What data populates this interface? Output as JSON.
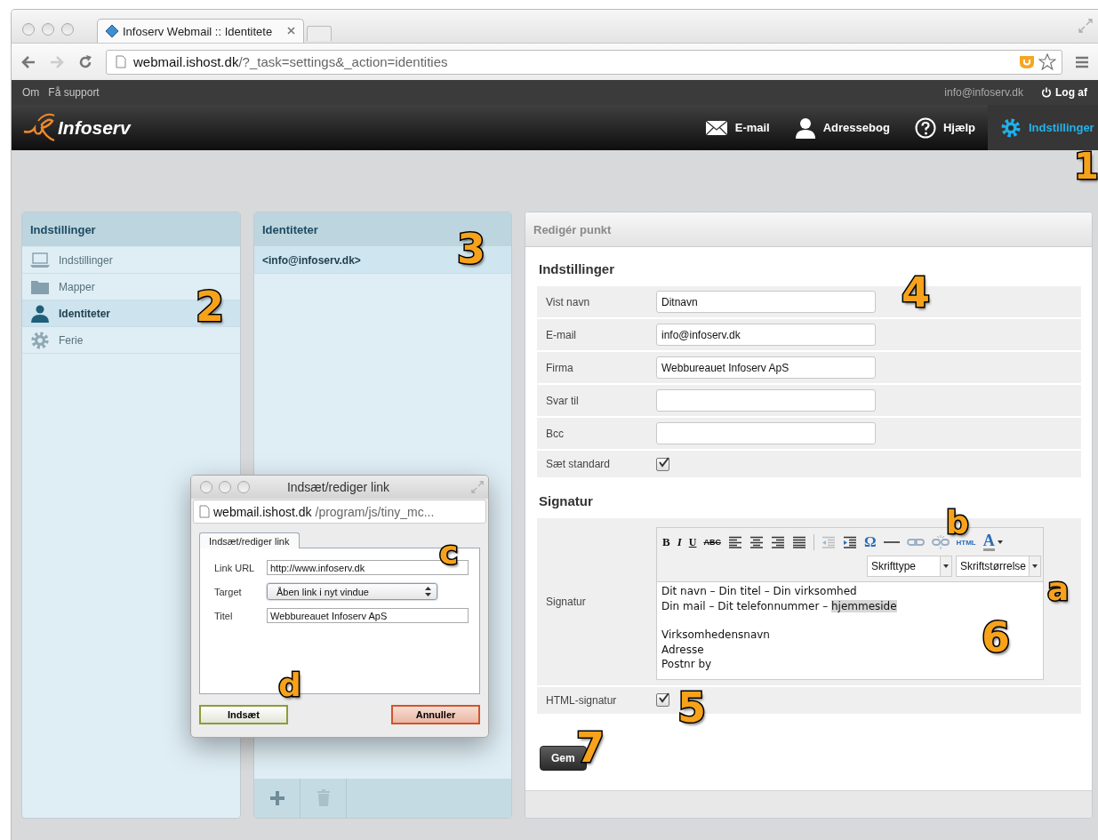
{
  "browser": {
    "tab_title": "Infoserv Webmail :: Identitete",
    "url_host": "webmail.ishost.dk",
    "url_path": "/?_task=settings&_action=identities"
  },
  "topbar": {
    "links": [
      "Om",
      "Få support"
    ],
    "user": "info@infoserv.dk",
    "logout": "Log af"
  },
  "header": {
    "logo": "Infoserv",
    "nav": [
      {
        "label": "E-mail",
        "selected": false
      },
      {
        "label": "Adressebog",
        "selected": false
      },
      {
        "label": "Hjælp",
        "selected": false
      },
      {
        "label": "Indstillinger",
        "selected": true
      }
    ]
  },
  "settings_panel": {
    "title": "Indstillinger",
    "items": [
      {
        "label": "Indstillinger",
        "selected": false
      },
      {
        "label": "Mapper",
        "selected": false
      },
      {
        "label": "Identiteter",
        "selected": true
      },
      {
        "label": "Ferie",
        "selected": false
      }
    ]
  },
  "identities_panel": {
    "title": "Identiteter",
    "items": [
      {
        "label": "<info@infoserv.dk>",
        "selected": true
      }
    ]
  },
  "edit_panel": {
    "title": "Redigér punkt",
    "save": "Gem",
    "sections": [
      {
        "title": "Indstillinger",
        "rows": [
          {
            "label": "Vist navn",
            "kind": "text",
            "value": "Ditnavn"
          },
          {
            "label": "E-mail",
            "kind": "text",
            "value": "info@infoserv.dk"
          },
          {
            "label": "Firma",
            "kind": "text",
            "value": "Webbureauet Infoserv ApS"
          },
          {
            "label": "Svar til",
            "kind": "text"
          },
          {
            "label": "Bcc",
            "kind": "text"
          },
          {
            "label": "Sæt standard",
            "kind": "checkbox",
            "checked": true
          }
        ]
      },
      {
        "title": "Signatur",
        "rows": [
          {
            "label": "Signatur",
            "kind": "editor"
          },
          {
            "label": "HTML-signatur",
            "kind": "checkbox",
            "checked": true
          }
        ]
      }
    ]
  },
  "editor": {
    "toolbar": [
      {
        "kind": "bold",
        "label": "B"
      },
      {
        "kind": "italic",
        "label": "I"
      },
      {
        "kind": "underline",
        "label": "U"
      },
      {
        "kind": "strike",
        "label": "ABC"
      },
      {
        "kind": "align-left"
      },
      {
        "kind": "align-center"
      },
      {
        "kind": "align-right"
      },
      {
        "kind": "align-justify"
      },
      {
        "kind": "separator"
      },
      {
        "kind": "outdent",
        "disabled": true
      },
      {
        "kind": "indent",
        "disabled": false
      },
      {
        "kind": "charmap",
        "label": "Ω"
      },
      {
        "kind": "hr"
      },
      {
        "kind": "link",
        "disabled": true
      },
      {
        "kind": "unlink",
        "disabled": true
      },
      {
        "kind": "html",
        "label": "HTML"
      },
      {
        "kind": "forecolor",
        "label": "A"
      }
    ],
    "font_select": "Skrifttype",
    "size_select": "Skriftstørrelse",
    "paragraphs": [
      [
        {
          "parts": [
            {
              "text": "Dit navn – Din titel – Din virksomhed",
              "selected": false
            }
          ]
        },
        {
          "parts": [
            {
              "text": "Din mail – Dit telefonnummer – ",
              "selected": false
            },
            {
              "text": "hjemmeside",
              "selected": true
            }
          ]
        }
      ],
      [
        {
          "parts": [
            {
              "text": "Virksomhedensnavn",
              "selected": false
            }
          ]
        },
        {
          "parts": [
            {
              "text": "Adresse",
              "selected": false
            }
          ]
        },
        {
          "parts": [
            {
              "text": "Postnr by",
              "selected": false
            }
          ]
        }
      ]
    ]
  },
  "link_dialog": {
    "title": "Indsæt/rediger link",
    "url_host": "webmail.ishost.dk",
    "url_path": "/program/js/tiny_mc...",
    "tab": "Indsæt/rediger link",
    "fields": [
      {
        "label": "Link URL",
        "kind": "text",
        "value": "http://www.infoserv.dk"
      },
      {
        "label": "Target",
        "kind": "select",
        "value": "Åben link i nyt vindue"
      },
      {
        "label": "Titel",
        "kind": "text",
        "value": "Webbureauet Infoserv ApS"
      }
    ],
    "buttons": [
      {
        "label": "Indsæt",
        "kind": "confirm"
      },
      {
        "label": "Annuller",
        "kind": "cancel"
      }
    ]
  },
  "callouts": [
    {
      "label": "1"
    },
    {
      "label": "2"
    },
    {
      "label": "3"
    },
    {
      "label": "4"
    },
    {
      "label": "a"
    },
    {
      "label": "b"
    },
    {
      "label": "c"
    },
    {
      "label": "d"
    },
    {
      "label": "5"
    },
    {
      "label": "6"
    },
    {
      "label": "7"
    }
  ]
}
